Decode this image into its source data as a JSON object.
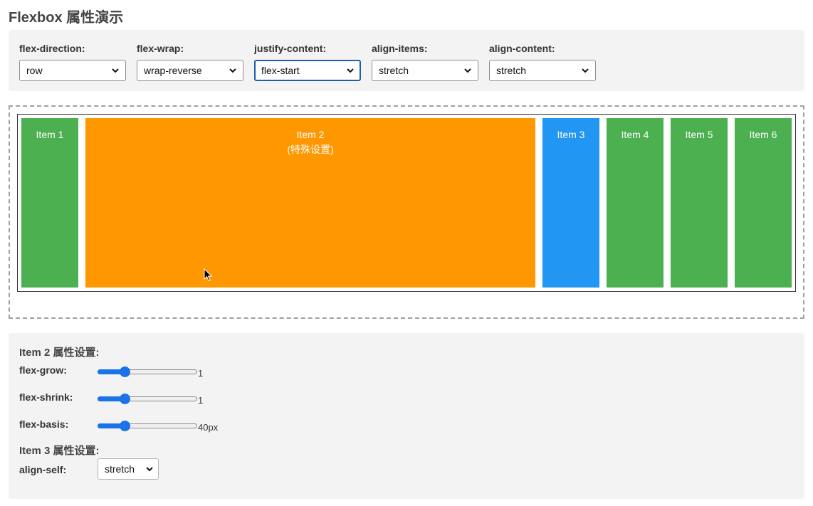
{
  "page": {
    "title": "Flexbox 属性演示"
  },
  "controls": [
    {
      "label": "flex-direction:",
      "value": "row"
    },
    {
      "label": "flex-wrap:",
      "value": "wrap-reverse"
    },
    {
      "label": "justify-content:",
      "value": "flex-start"
    },
    {
      "label": "align-items:",
      "value": "stretch"
    },
    {
      "label": "align-content:",
      "value": "stretch"
    }
  ],
  "items": [
    {
      "label": "Item 1",
      "sub": "",
      "color": "#4caf50"
    },
    {
      "label": "Item 2",
      "sub": "(特殊设置)",
      "color": "#ff9800"
    },
    {
      "label": "Item 3",
      "sub": "",
      "color": "#2196f3"
    },
    {
      "label": "Item 4",
      "sub": "",
      "color": "#4caf50"
    },
    {
      "label": "Item 5",
      "sub": "",
      "color": "#4caf50"
    },
    {
      "label": "Item 6",
      "sub": "",
      "color": "#4caf50"
    }
  ],
  "item2_settings": {
    "heading": "Item 2 属性设置:",
    "flex_grow": {
      "label": "flex-grow:",
      "value": "1",
      "fraction": 0.25
    },
    "flex_shrink": {
      "label": "flex-shrink:",
      "value": "1",
      "fraction": 0.25
    },
    "flex_basis": {
      "label": "flex-basis:",
      "value": "40px",
      "fraction": 0.25
    }
  },
  "item3_settings": {
    "heading": "Item 3 属性设置:",
    "align_self": {
      "label": "align-self:",
      "value": "stretch"
    }
  },
  "colors": {
    "green": "#4caf50",
    "orange": "#ff9800",
    "blue": "#2196f3",
    "accent": "#1a73e8",
    "focus": "#1a5fb4"
  }
}
